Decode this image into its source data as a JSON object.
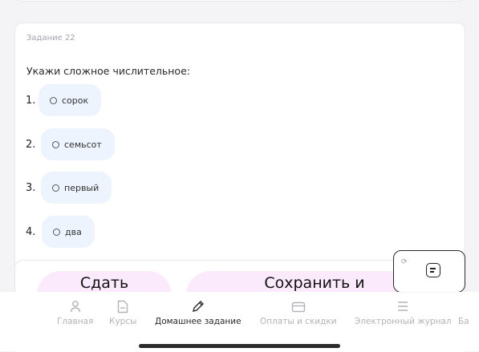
{
  "task": {
    "number_label": "Задание 22",
    "question": "Укажи сложное числительное:",
    "options": [
      {
        "num": "1.",
        "label": "сорок"
      },
      {
        "num": "2.",
        "label": "семьсот"
      },
      {
        "num": "3.",
        "label": "первый"
      },
      {
        "num": "4.",
        "label": "два"
      }
    ]
  },
  "actions": {
    "submit_label": "Сдать",
    "save_label": "Сохранить и"
  },
  "nav": {
    "items": [
      {
        "label": "Главная",
        "icon": "user-icon",
        "active": false
      },
      {
        "label": "Курсы",
        "icon": "document-icon",
        "active": false
      },
      {
        "label": "Домашнее задание",
        "icon": "pencil-icon",
        "active": true
      },
      {
        "label": "Оплаты и скидки",
        "icon": "wallet-icon",
        "active": false
      },
      {
        "label": "Электронный журнал",
        "icon": "menu-icon",
        "active": false
      },
      {
        "label": "Ба",
        "icon": "",
        "active": false
      }
    ]
  },
  "colors": {
    "option_bg": "#eef4fe",
    "action_bg": "#fbeafc",
    "nav_active": "#2a2a2a",
    "nav_inactive": "#b3b3b9"
  }
}
